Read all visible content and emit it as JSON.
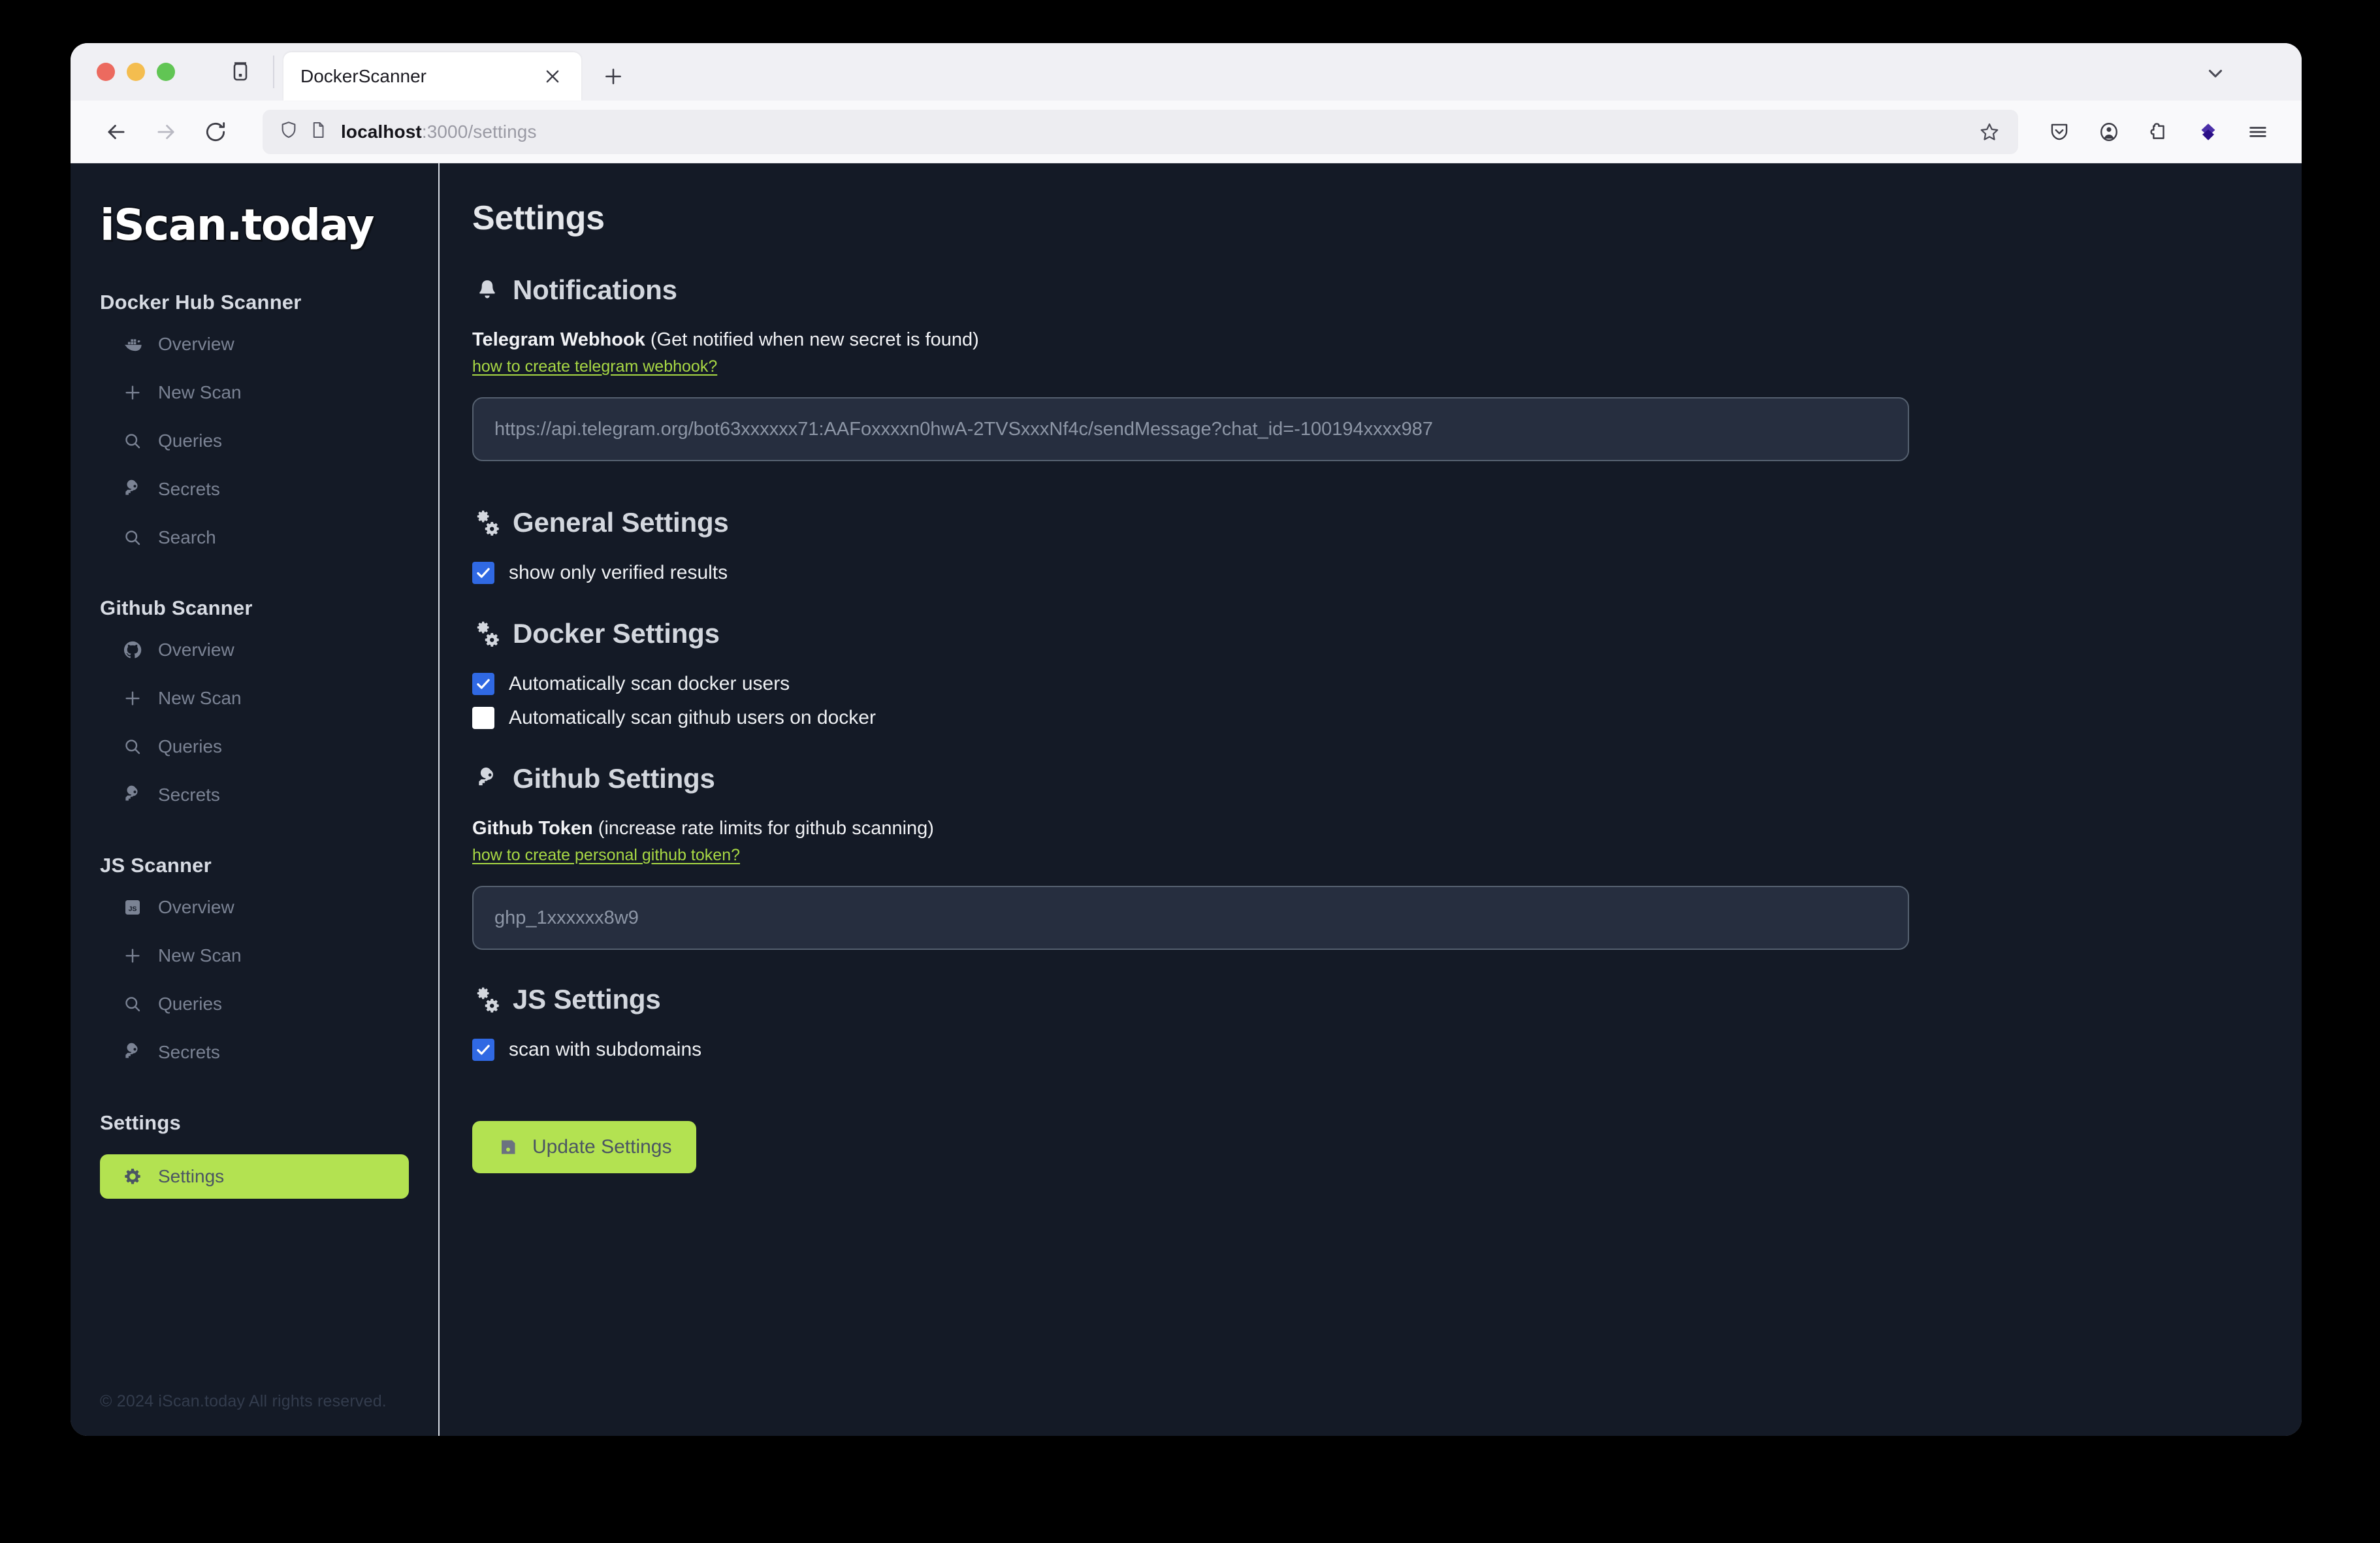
{
  "browser": {
    "tab": {
      "title": "DockerScanner",
      "close_label": "×"
    },
    "new_tab_label": "+",
    "url": {
      "host": "localhost",
      "path": ":3000/settings"
    },
    "icons": {
      "tab_list": "tab-list-icon",
      "tabstrip_chevron": "chevron-down-icon",
      "back": "back-arrow-icon",
      "forward": "forward-arrow-icon",
      "reload": "reload-icon",
      "shield": "shield-icon",
      "page": "page-icon",
      "bookmark": "star-icon",
      "pocket": "pocket-icon",
      "account": "account-icon",
      "extension": "extension-icon",
      "diamond_extension": "diamond-extension-icon",
      "menu": "hamburger-menu-icon"
    }
  },
  "sidebar": {
    "logo": "iScan.today",
    "groups": [
      {
        "title": "Docker Hub Scanner",
        "items": [
          {
            "label": "Overview",
            "icon": "docker-whale-icon",
            "active": false
          },
          {
            "label": "New Scan",
            "icon": "plus-icon",
            "active": false
          },
          {
            "label": "Queries",
            "icon": "search-icon",
            "active": false
          },
          {
            "label": "Secrets",
            "icon": "key-icon",
            "active": false
          },
          {
            "label": "Search",
            "icon": "search-icon",
            "active": false
          }
        ]
      },
      {
        "title": "Github Scanner",
        "items": [
          {
            "label": "Overview",
            "icon": "github-icon",
            "active": false
          },
          {
            "label": "New Scan",
            "icon": "plus-icon",
            "active": false
          },
          {
            "label": "Queries",
            "icon": "search-icon",
            "active": false
          },
          {
            "label": "Secrets",
            "icon": "key-icon",
            "active": false
          }
        ]
      },
      {
        "title": "JS Scanner",
        "items": [
          {
            "label": "Overview",
            "icon": "js-badge-icon",
            "active": false
          },
          {
            "label": "New Scan",
            "icon": "plus-icon",
            "active": false
          },
          {
            "label": "Queries",
            "icon": "search-icon",
            "active": false
          },
          {
            "label": "Secrets",
            "icon": "key-icon",
            "active": false
          }
        ]
      },
      {
        "title": "Settings",
        "items": [
          {
            "label": "Settings",
            "icon": "gear-icon",
            "active": true
          }
        ]
      }
    ],
    "footer": "© 2024 iScan.today All rights reserved."
  },
  "main": {
    "page_title": "Settings",
    "notifications": {
      "heading": "Notifications",
      "heading_icon": "bell-icon",
      "field_label_bold": "Telegram Webhook",
      "field_label_rest": " (Get notified when new secret is found)",
      "help_link": "how to create telegram webhook?",
      "input_value": "",
      "input_placeholder": "https://api.telegram.org/bot63xxxxxx71:AAFoxxxxn0hwA-2TVSxxxNf4c/sendMessage?chat_id=-100194xxxx987"
    },
    "general": {
      "heading": "General Settings",
      "heading_icon": "gears-icon",
      "checkboxes": [
        {
          "label": "show only verified results",
          "checked": true
        }
      ]
    },
    "docker": {
      "heading": "Docker Settings",
      "heading_icon": "gears-icon",
      "checkboxes": [
        {
          "label": "Automatically scan docker users",
          "checked": true
        },
        {
          "label": "Automatically scan github users on docker",
          "checked": false
        }
      ]
    },
    "github": {
      "heading": "Github Settings",
      "heading_icon": "key-icon",
      "field_label_bold": "Github Token",
      "field_label_rest": " (increase rate limits for github scanning)",
      "help_link": "how to create personal github token?",
      "input_value": "",
      "input_placeholder": "ghp_1xxxxxx8w9"
    },
    "js": {
      "heading": "JS Settings",
      "heading_icon": "gears-icon",
      "checkboxes": [
        {
          "label": "scan with subdomains",
          "checked": true
        }
      ]
    },
    "update_button": {
      "label": "Update Settings",
      "icon": "save-floppy-icon"
    }
  },
  "colors": {
    "accent_green": "#b3e251",
    "link_green": "#a8d844",
    "checkbox_blue": "#3069e3",
    "app_bg": "#141a26",
    "input_bg": "#262e3f"
  }
}
